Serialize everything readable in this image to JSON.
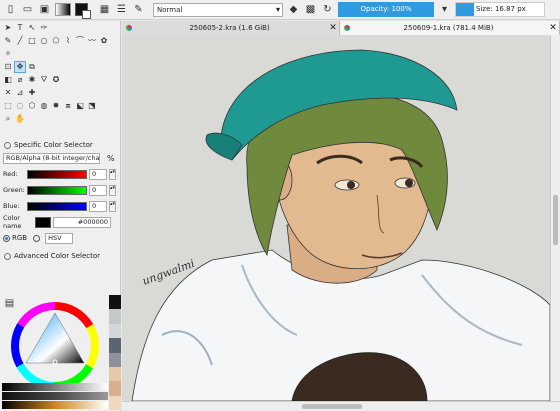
{
  "toolbar": {
    "blend_mode": "Normal",
    "opacity_label": "Opacity: 100%",
    "size_label": "Size: 16.87 px",
    "icons": [
      "new-document-icon",
      "open-document-icon",
      "save-icon",
      "gradient-swatch-icon",
      "color-swatch-icon",
      "brush-presets-icon",
      "edit-brush-icon",
      "eraser-icon",
      "alpha-lock-icon",
      "reload-preset-icon",
      "mirror-icon"
    ]
  },
  "tabs": [
    {
      "label": "250605-2.kra (1.6 GiB)",
      "active": false
    },
    {
      "label": "250609-1.kra (781.4 MiB)",
      "active": true
    }
  ],
  "color_selector": {
    "title": "Specific Color Selector",
    "model_dropdown": "RGB/Alpha (8-bit integer/cha…",
    "percent_symbol": "%",
    "red_label": "Red:",
    "red_value": "0",
    "green_label": "Green:",
    "green_value": "0",
    "blue_label": "Blue:",
    "blue_value": "0",
    "color_name_label": "Color name",
    "color_name_value": "#000000",
    "radio_rgb": "RGB",
    "radio_hsv": "HSV"
  },
  "advanced_selector": {
    "title": "Advanced Color Selector"
  },
  "canvas": {
    "signature": "ungwalmi"
  },
  "colors": {
    "accent": "#2e9ae0",
    "cap": "#1f9a93",
    "hair": "#6f8a3c",
    "skin": "#e3b98f",
    "shirt": "#f4f6f8"
  },
  "palette": [
    "#111111",
    "#c4c8c6",
    "#d4d7d9",
    "#5b6470",
    "#8d919a",
    "#e8c8a8",
    "#d8b08d",
    "#f0d8c0"
  ]
}
